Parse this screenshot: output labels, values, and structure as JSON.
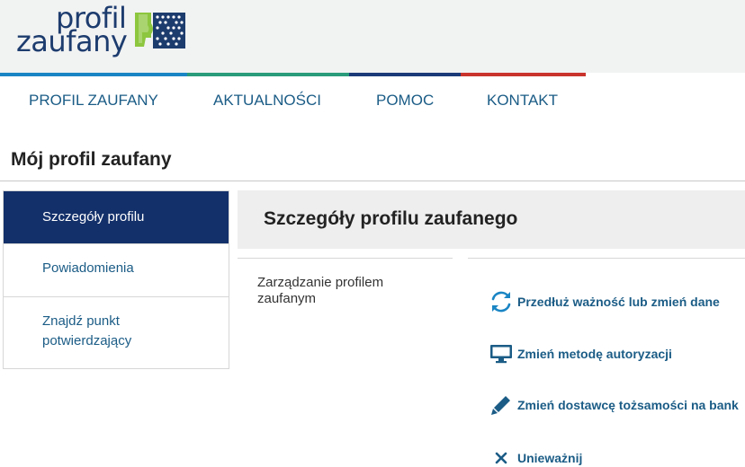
{
  "logo": {
    "line1": "profil",
    "line2": "zaufany"
  },
  "colors": {
    "brand_navy": "#13306a",
    "link_blue": "#1b5c86",
    "logo_green": "#8dc63f",
    "strip": [
      "#1a85c4",
      "#2a9b7b",
      "#1b3a78",
      "#c9332c"
    ]
  },
  "nav": [
    {
      "label": "PROFIL ZAUFANY"
    },
    {
      "label": "AKTUALNOŚCI"
    },
    {
      "label": "POMOC"
    },
    {
      "label": "KONTAKT"
    }
  ],
  "page_title": "Mój profil zaufany",
  "side_menu": [
    {
      "label": "Szczegóły profilu",
      "active": true
    },
    {
      "label": "Powiadomienia",
      "active": false
    },
    {
      "label_line1": "Znajdź punkt",
      "label_line2": "potwierdzający",
      "active": false
    }
  ],
  "content": {
    "title": "Szczegóły profilu zaufanego",
    "section_label_line1": "Zarządzanie profilem",
    "section_label_line2": "zaufanym",
    "actions": [
      {
        "label": "Przedłuż ważność lub zmień dane",
        "icon": "refresh-icon"
      },
      {
        "label": "Zmień metodę autoryzacji",
        "icon": "monitor-icon"
      },
      {
        "label": "Zmień dostawcę tożsamości na bank",
        "icon": "pencil-icon"
      },
      {
        "label": "Unieważnij",
        "icon": "close-icon"
      }
    ]
  }
}
